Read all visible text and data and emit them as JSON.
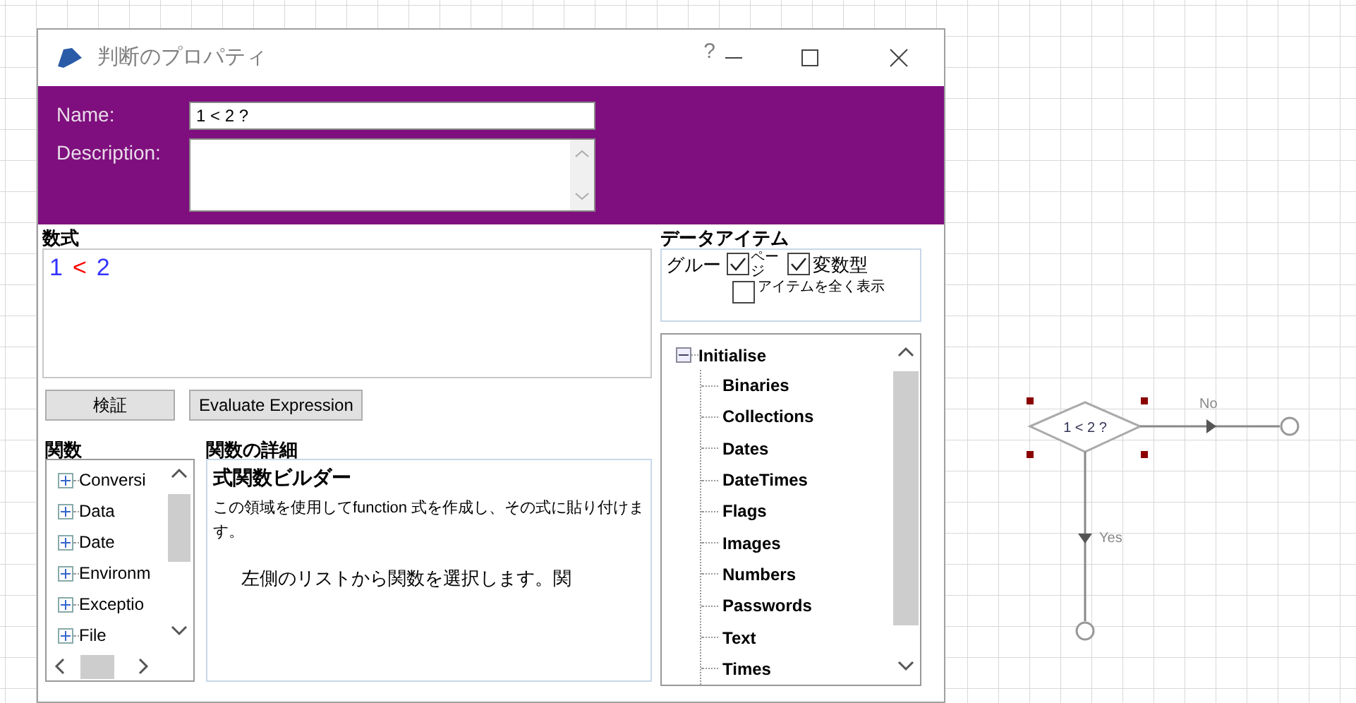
{
  "window": {
    "title": "判断のプロパティ",
    "help": "?"
  },
  "name_field": {
    "label": "Name:",
    "value": "1 < 2 ?"
  },
  "description_field": {
    "label": "Description:"
  },
  "expression": {
    "label": "数式",
    "tokens": [
      {
        "text": "1",
        "color": "#3333ff"
      },
      {
        "text": "<",
        "color": "#ff0000"
      },
      {
        "text": "2",
        "color": "#3333ff"
      }
    ]
  },
  "buttons": [
    "検証",
    "Evaluate Expression"
  ],
  "functions": {
    "label": "関数",
    "items": [
      {
        "label": "Conversi",
        "expanded": false
      },
      {
        "label": "Data",
        "expanded": false
      },
      {
        "label": "Date",
        "expanded": false
      },
      {
        "label": "Environm",
        "expanded": false
      },
      {
        "label": "Exceptio",
        "expanded": false
      },
      {
        "label": "File",
        "expanded": false
      }
    ]
  },
  "function_details": {
    "label": "関数の詳細",
    "heading": "式関数ビルダー",
    "description": "この領域を使用してfunction 式を作成し、その式に貼り付けます。",
    "hint": "左側のリストから関数を選択します。関"
  },
  "data_items": {
    "label": "データアイテム",
    "group_label": "グルー",
    "options": [
      {
        "label": "ページ",
        "checked": true
      },
      {
        "label": "変数型",
        "checked": true
      },
      {
        "label": "アイテムを全く表示",
        "checked": false
      }
    ],
    "tree": [
      {
        "label": "Initialise",
        "expanded": true,
        "children": [
          {
            "label": "Binaries"
          },
          {
            "label": "Collections"
          },
          {
            "label": "Dates"
          },
          {
            "label": "DateTimes"
          },
          {
            "label": "Flags"
          },
          {
            "label": "Images"
          },
          {
            "label": "Numbers"
          },
          {
            "label": "Passwords"
          },
          {
            "label": "Text"
          },
          {
            "label": "Times"
          }
        ]
      }
    ]
  },
  "diagram": {
    "node": {
      "label": "1 < 2 ?",
      "selected": true
    },
    "branches": [
      {
        "label": "No"
      },
      {
        "label": "Yes"
      }
    ]
  }
}
